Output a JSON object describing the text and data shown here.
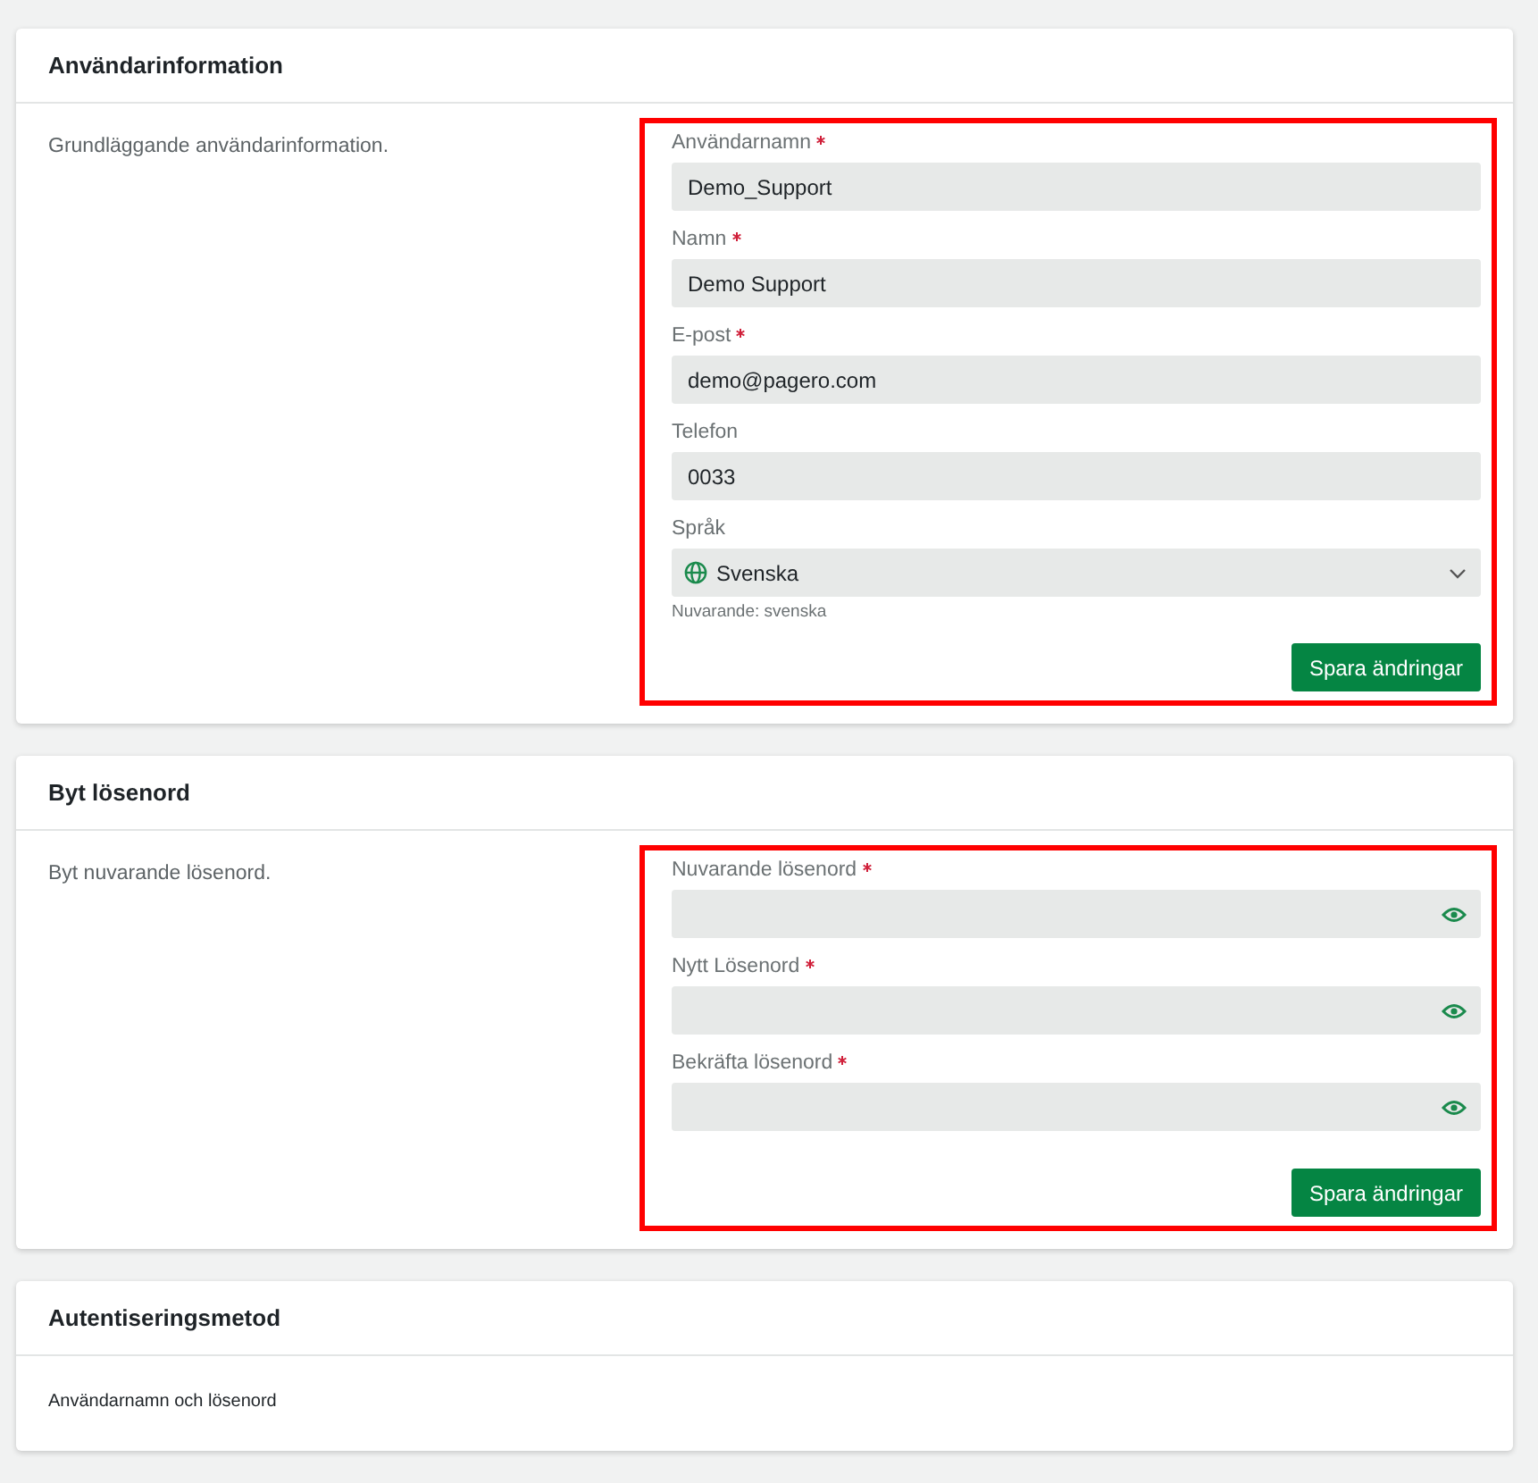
{
  "sections": [
    {
      "title": "Användarinformation",
      "description": "Grundläggande användarinformation.",
      "highlighted": true,
      "fields": [
        {
          "kind": "text",
          "label": "Användarnamn",
          "required": true,
          "value": "Demo_Support"
        },
        {
          "kind": "text",
          "label": "Namn",
          "required": true,
          "value": "Demo Support"
        },
        {
          "kind": "text",
          "label": "E-post",
          "required": true,
          "value": "demo@pagero.com"
        },
        {
          "kind": "text",
          "label": "Telefon",
          "required": false,
          "value": "0033"
        },
        {
          "kind": "select",
          "label": "Språk",
          "required": false,
          "value": "Svenska",
          "hint": "Nuvarande: svenska"
        }
      ],
      "button": "Spara ändringar"
    },
    {
      "title": "Byt lösenord",
      "description": "Byt nuvarande lösenord.",
      "highlighted": true,
      "fields": [
        {
          "kind": "password",
          "label": "Nuvarande lösenord",
          "required": true
        },
        {
          "kind": "password",
          "label": "Nytt Lösenord",
          "required": true
        },
        {
          "kind": "password",
          "label": "Bekräfta lösenord",
          "required": true
        }
      ],
      "button": "Spara ändringar"
    },
    {
      "title": "Autentiseringsmetod",
      "text": "Användarnamn och lösenord"
    }
  ]
}
